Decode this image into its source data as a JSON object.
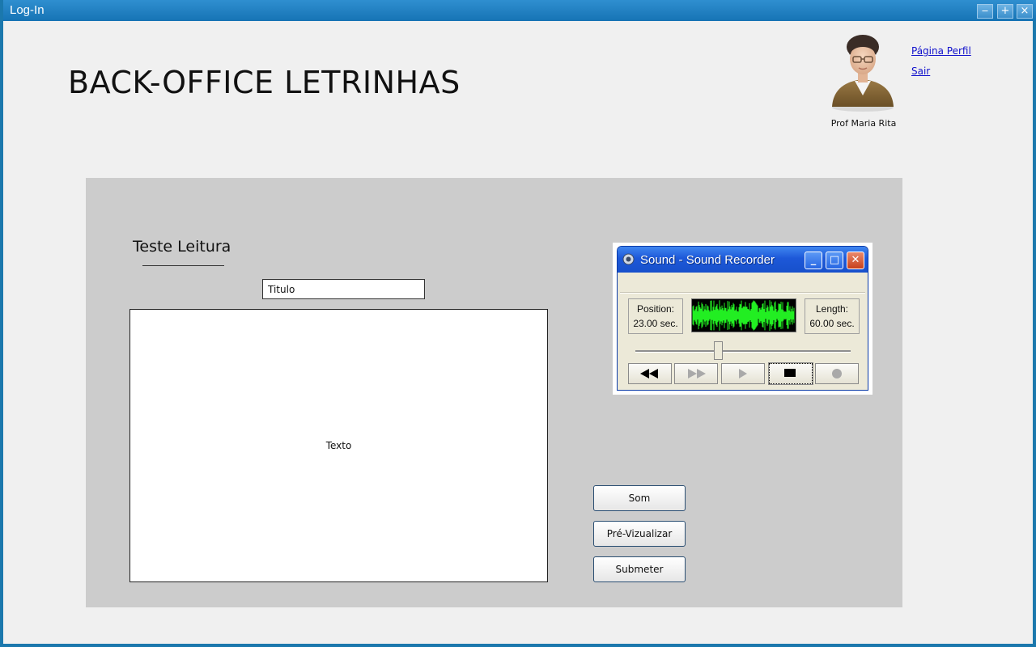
{
  "window": {
    "title": "Log-In",
    "minimize": "‒",
    "maximize": "+",
    "close": "×"
  },
  "header": {
    "app_title": "BACK-OFFICE LETRINHAS",
    "user_name": "Prof Maria Rita",
    "profile_link": "Página Perfil",
    "logout_link": "Sair"
  },
  "form": {
    "section_title": "Teste Leitura",
    "title_field": {
      "placeholder": "Titulo"
    },
    "text_field": {
      "placeholder": "Texto"
    }
  },
  "recorder": {
    "title": "Sound - Sound Recorder",
    "position_label": "Position:",
    "position_value": "23.00 sec.",
    "length_label": "Length:",
    "length_value": "60.00 sec.",
    "progress": 0.383
  },
  "actions": {
    "som": "Som",
    "preview": "Pré-Vizualizar",
    "submit": "Submeter"
  },
  "colors": {
    "titlebar": "#1673b4",
    "panel": "#cccccc",
    "wave": "#22ee22",
    "link": "#1010cc"
  }
}
